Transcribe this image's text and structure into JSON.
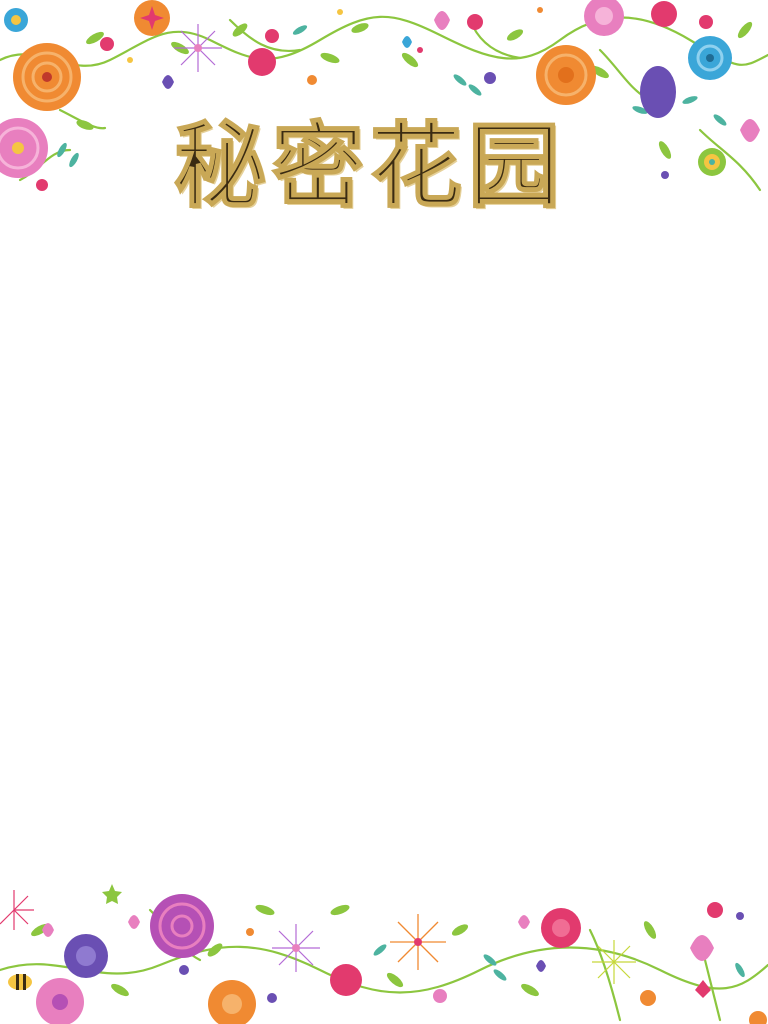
{
  "title": {
    "text": "秘密花园"
  },
  "colors": {
    "title_fill": "#3a2b12",
    "title_ornament": "#c9a856",
    "background": "#ffffff",
    "flower_orange": "#f08a32",
    "flower_pink": "#e87fbf",
    "flower_magenta": "#e23a6e",
    "flower_blue": "#3aa6d8",
    "flower_purple": "#6a4fb3",
    "leaf_green": "#8cc63f",
    "leaf_teal": "#4db3a0",
    "flower_yellow": "#f5c542"
  },
  "decorations": {
    "top_border": "floral-border-top",
    "bottom_border": "floral-border-bottom"
  }
}
